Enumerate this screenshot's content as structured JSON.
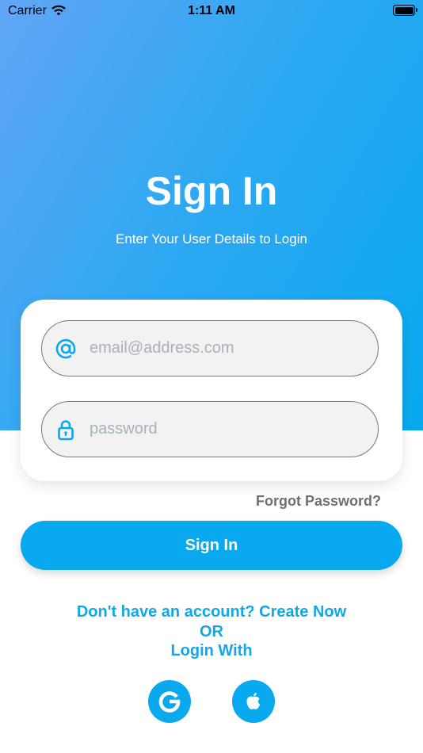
{
  "status_bar": {
    "carrier": "Carrier",
    "time": "1:11 AM"
  },
  "header": {
    "title": "Sign In",
    "subtitle": "Enter Your User Details to Login"
  },
  "form": {
    "email_placeholder": "email@address.com",
    "email_value": "",
    "password_placeholder": "password",
    "password_value": "",
    "forgot_password": "Forgot Password?",
    "submit_label": "Sign In"
  },
  "footer": {
    "create_account": "Don't have an account? Create Now",
    "or": "OR",
    "login_with": "Login With"
  },
  "social": {
    "google_icon": "google-icon",
    "apple_icon": "apple-icon"
  },
  "colors": {
    "accent": "#08a9ef",
    "gradient_start": "#62a6f6",
    "link": "#12a7e8",
    "forgot_text": "#6f6f6f"
  }
}
